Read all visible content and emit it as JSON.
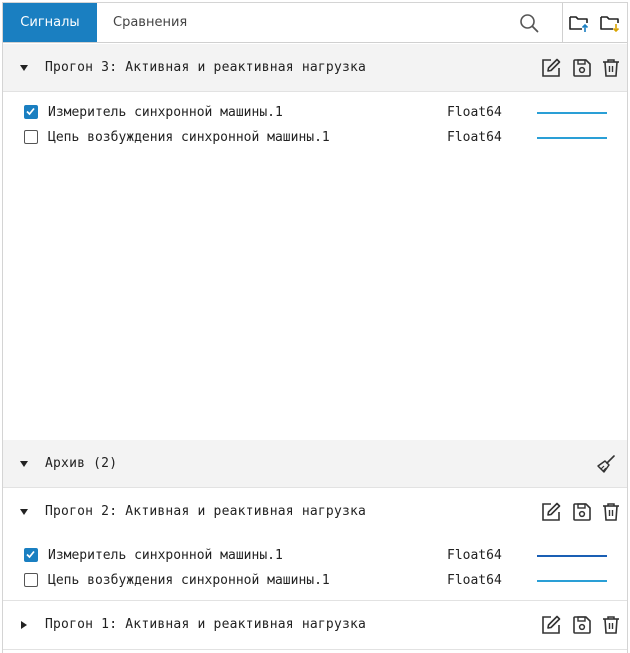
{
  "tabs": {
    "signals": "Сигналы",
    "comparison": "Сравнения"
  },
  "icons": {
    "search": "search-icon",
    "folder_upload": "folder-upload-icon",
    "folder_download": "folder-download-icon",
    "edit": "edit-icon",
    "save": "save-icon",
    "delete": "trash-icon",
    "broom": "broom-icon"
  },
  "colors": {
    "accent": "#1a7fc1",
    "upload_arrow": "#1a7fc1",
    "download_arrow": "#d9a400",
    "series_dark": "#1a5fb4",
    "series_light": "#2a9fd6"
  },
  "current_run": {
    "title": "Прогон 3: Активная и реактивная нагрузка",
    "signals": [
      {
        "name": "Измеритель синхронной машины.1",
        "type": "Float64",
        "checked": true,
        "color": "#2a9fd6"
      },
      {
        "name": "Цепь возбуждения синхронной машины.1",
        "type": "Float64",
        "checked": false,
        "color": "#2a9fd6"
      }
    ]
  },
  "archive": {
    "title": "Архив (2)"
  },
  "run2": {
    "title": "Прогон 2: Активная и реактивная нагрузка",
    "signals": [
      {
        "name": "Измеритель синхронной машины.1",
        "type": "Float64",
        "checked": true,
        "color": "#1a5fb4"
      },
      {
        "name": "Цепь возбуждения синхронной машины.1",
        "type": "Float64",
        "checked": false,
        "color": "#2a9fd6"
      }
    ]
  },
  "run1": {
    "title": "Прогон 1: Активная и реактивная нагрузка"
  }
}
